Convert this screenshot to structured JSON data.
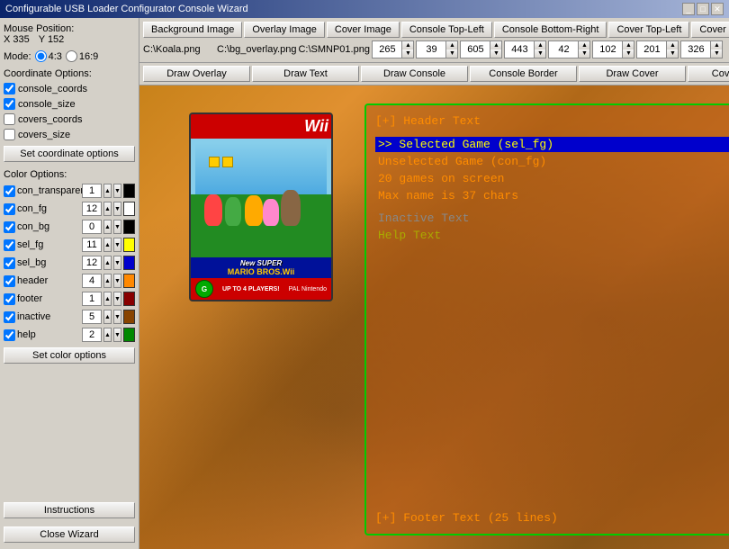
{
  "window": {
    "title": "Configurable USB Loader Configurator Console Wizard"
  },
  "toolbar": {
    "btn_background": "Background Image",
    "btn_overlay": "Overlay Image",
    "btn_cover": "Cover Image",
    "btn_console_tl": "Console Top-Left",
    "btn_console_br": "Console Bottom-Right",
    "btn_cover_tl": "Cover Top-Left",
    "btn_cover_br": "Cover Bottom-Right",
    "path_bg": "C:\\Koala.png",
    "path_overlay": "C:\\bg_overlay.png",
    "path_cover": "C:\\SMNP01.png",
    "console_tl_x": "265",
    "console_tl_y": "39",
    "console_br_x": "605",
    "console_br_y": "443",
    "cover_tl_x": "42",
    "cover_tl_y": "102",
    "cover_br_x": "201",
    "cover_br_y": "326"
  },
  "action_buttons": {
    "draw_overlay": "Draw Overlay",
    "draw_text": "Draw Text",
    "draw_console": "Draw Console",
    "console_border": "Console Border",
    "draw_cover": "Draw Cover",
    "cover_border": "Cover Border"
  },
  "left_panel": {
    "mouse_pos_label": "Mouse Position:",
    "mouse_x": "X  335",
    "mouse_y": "Y  152",
    "mode_label": "Mode:",
    "mode_43": "4:3",
    "mode_169": "16:9",
    "coord_options_label": "Coordinate Options:",
    "coord_console": "console_coords",
    "coord_size": "console_size",
    "coord_covers": "covers_coords",
    "coord_covers_size": "covers_size",
    "btn_set_coord": "Set coordinate options",
    "color_options_label": "Color Options:",
    "colors": [
      {
        "label": "con_transparent",
        "num": "1",
        "swatch": "#000000",
        "checked": true
      },
      {
        "label": "con_fg",
        "num": "12",
        "swatch": "#ffffff",
        "checked": true
      },
      {
        "label": "con_bg",
        "num": "0",
        "swatch": "#000000",
        "checked": true
      },
      {
        "label": "sel_fg",
        "num": "11",
        "swatch": "#ffff00",
        "checked": true
      },
      {
        "label": "sel_bg",
        "num": "12",
        "swatch": "#0000cc",
        "checked": true
      },
      {
        "label": "header",
        "num": "4",
        "swatch": "#ff8800",
        "checked": true
      },
      {
        "label": "footer",
        "num": "1",
        "swatch": "#880000",
        "checked": true
      },
      {
        "label": "inactive",
        "num": "5",
        "swatch": "#884400",
        "checked": true
      },
      {
        "label": "help",
        "num": "2",
        "swatch": "#008800",
        "checked": true
      }
    ],
    "btn_set_color": "Set color options",
    "btn_instructions": "Instructions",
    "btn_close": "Close Wizard"
  },
  "console_display": {
    "header": "[+] Header Text",
    "selected": ">> Selected Game (sel_fg)",
    "unselected": "    Unselected Game (con_fg)",
    "games_count": "    20 games on screen",
    "max_name": "    Max name is 37 chars",
    "inactive": "    Inactive Text",
    "help": "    Help Text",
    "footer": "[+] Footer Text (25 lines)"
  }
}
